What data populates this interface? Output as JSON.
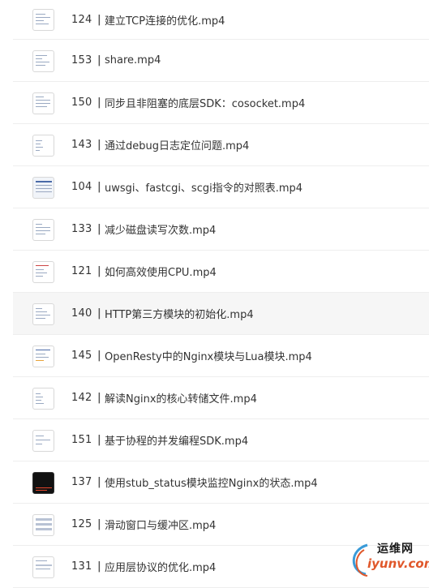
{
  "items": [
    {
      "num": "124",
      "sep": "|",
      "title": "建立TCP连接的优化.mp4",
      "thumb": "light"
    },
    {
      "num": "153",
      "sep": "|",
      "title": "share.mp4",
      "thumb": "light"
    },
    {
      "num": "150",
      "sep": "|",
      "title": "同步且非阻塞的底层SDK：cosocket.mp4",
      "thumb": "light"
    },
    {
      "num": "143",
      "sep": "|",
      "title": "通过debug日志定位问题.mp4",
      "thumb": "light"
    },
    {
      "num": "104",
      "sep": "|",
      "title": "uwsgi、fastcgi、scgi指令的对照表.mp4",
      "thumb": "blue"
    },
    {
      "num": "133",
      "sep": "|",
      "title": "减少磁盘读写次数.mp4",
      "thumb": "light"
    },
    {
      "num": "121",
      "sep": "|",
      "title": "如何高效使用CPU.mp4",
      "thumb": "light"
    },
    {
      "num": "140",
      "sep": "|",
      "title": "HTTP第三方模块的初始化.mp4",
      "thumb": "light"
    },
    {
      "num": "145",
      "sep": "|",
      "title": "OpenResty中的Nginx模块与Lua模块.mp4",
      "thumb": "light"
    },
    {
      "num": "142",
      "sep": "|",
      "title": "解读Nginx的核心转储文件.mp4",
      "thumb": "light"
    },
    {
      "num": "151",
      "sep": "|",
      "title": "基于协程的并发编程SDK.mp4",
      "thumb": "light"
    },
    {
      "num": "137",
      "sep": "|",
      "title": "使用stub_status模块监控Nginx的状态.mp4",
      "thumb": "dark"
    },
    {
      "num": "125",
      "sep": "|",
      "title": "滑动窗口与缓冲区.mp4",
      "thumb": "light"
    },
    {
      "num": "131",
      "sep": "|",
      "title": "应用层协议的优化.mp4",
      "thumb": "light"
    }
  ],
  "watermark": {
    "cn": "运维网",
    "en": "iyunv.com"
  },
  "colors": {
    "border": "#eeeeee",
    "text": "#333333",
    "highlight": "#f6f6f6",
    "watermark_accent": "#e0572a"
  }
}
